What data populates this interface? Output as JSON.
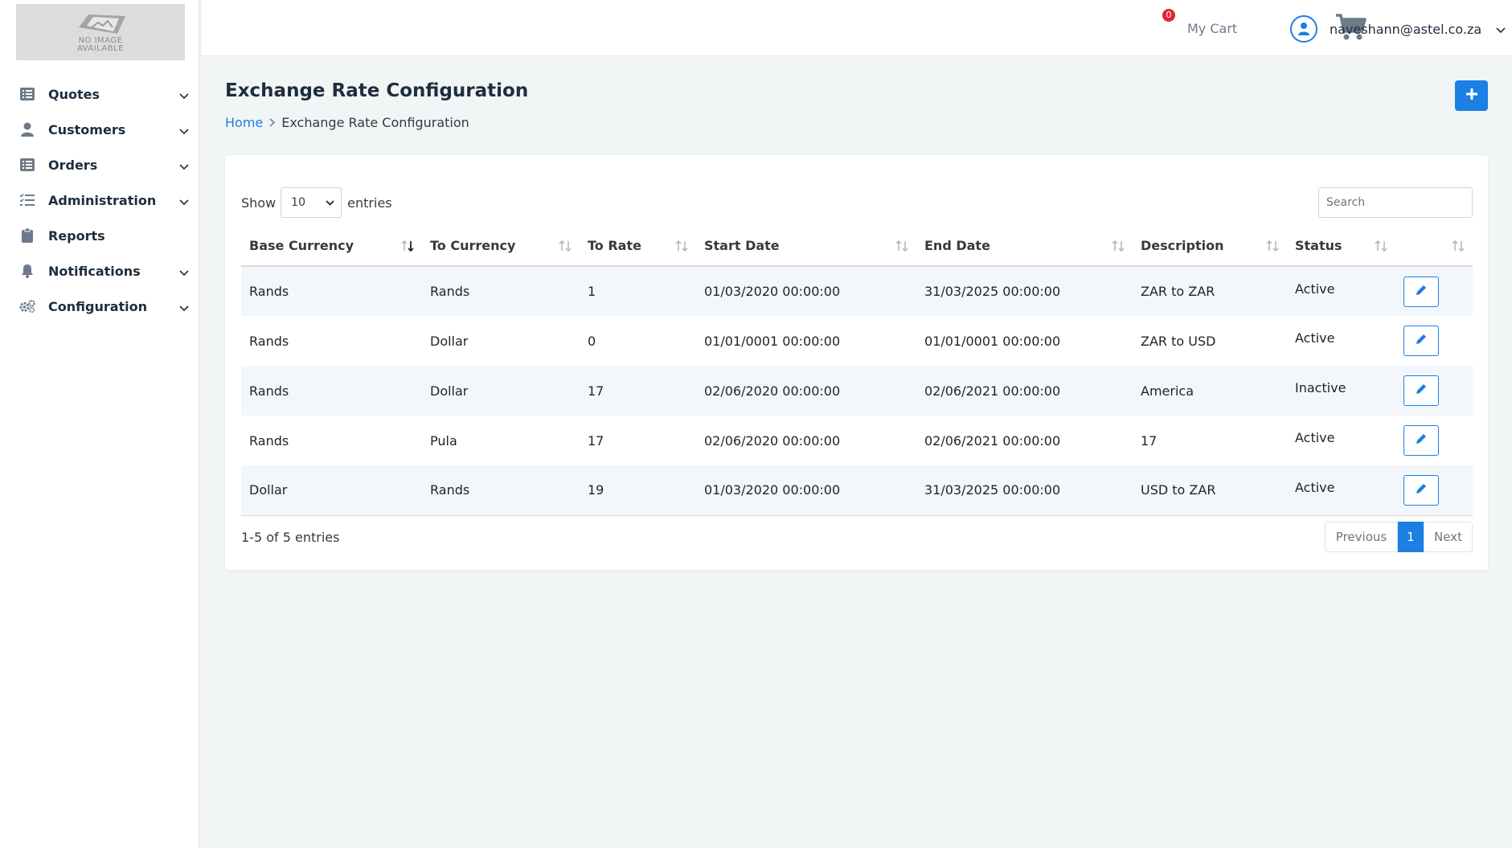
{
  "logo": {
    "line1": "NO IMAGE",
    "line2": "AVAILABLE"
  },
  "sidebar": {
    "items": [
      {
        "label": "Quotes",
        "icon": "list-icon"
      },
      {
        "label": "Customers",
        "icon": "user-icon"
      },
      {
        "label": "Orders",
        "icon": "list-icon"
      },
      {
        "label": "Administration",
        "icon": "tasks-icon"
      },
      {
        "label": "Reports",
        "icon": "clipboard-icon"
      },
      {
        "label": "Notifications",
        "icon": "bell-icon"
      },
      {
        "label": "Configuration",
        "icon": "gears-icon"
      }
    ]
  },
  "header": {
    "cart_count": "0",
    "cart_label": "My Cart",
    "user_email": "naveshann@astel.co.za"
  },
  "page": {
    "title": "Exchange Rate Configuration",
    "breadcrumb_home": "Home",
    "breadcrumb_current": "Exchange Rate Configuration",
    "accent_color": "#1b7fe3"
  },
  "table_controls": {
    "show_label": "Show",
    "page_length": "10",
    "entries_label": "entries",
    "search_placeholder": "Search"
  },
  "table": {
    "columns": [
      "Base Currency",
      "To Currency",
      "To Rate",
      "Start Date",
      "End Date",
      "Description",
      "Status",
      ""
    ],
    "rows": [
      [
        "Rands",
        "Rands",
        "1",
        "01/03/2020 00:00:00",
        "31/03/2025 00:00:00",
        "ZAR to ZAR",
        "Active"
      ],
      [
        "Rands",
        "Dollar",
        "0",
        "01/01/0001 00:00:00",
        "01/01/0001 00:00:00",
        "ZAR to USD",
        "Active"
      ],
      [
        "Rands",
        "Dollar",
        "17",
        "02/06/2020 00:00:00",
        "02/06/2021 00:00:00",
        "America",
        "Inactive"
      ],
      [
        "Rands",
        "Pula",
        "17",
        "02/06/2020 00:00:00",
        "02/06/2021 00:00:00",
        "17",
        "Active"
      ],
      [
        "Dollar",
        "Rands",
        "19",
        "01/03/2020 00:00:00",
        "31/03/2025 00:00:00",
        "USD to ZAR",
        "Active"
      ]
    ]
  },
  "footer": {
    "info": "1-5 of 5 entries",
    "previous": "Previous",
    "current_page": "1",
    "next": "Next"
  }
}
